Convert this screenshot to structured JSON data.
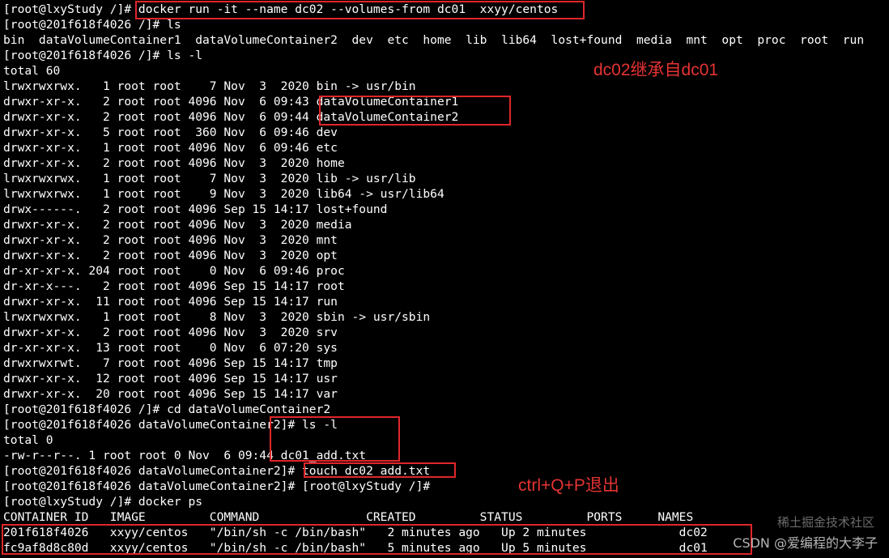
{
  "terminal": {
    "lines": [
      "[root@lxyStudy /]# docker run -it --name dc02 --volumes-from dc01  xxyy/centos",
      "[root@201f618f4026 /]# ls",
      "bin  dataVolumeContainer1  dataVolumeContainer2  dev  etc  home  lib  lib64  lost+found  media  mnt  opt  proc  root  run",
      "[root@201f618f4026 /]# ls -l",
      "total 60",
      "lrwxrwxrwx.   1 root root    7 Nov  3  2020 bin -> usr/bin",
      "drwxr-xr-x.   2 root root 4096 Nov  6 09:43 dataVolumeContainer1",
      "drwxr-xr-x.   2 root root 4096 Nov  6 09:44 dataVolumeContainer2",
      "drwxr-xr-x.   5 root root  360 Nov  6 09:46 dev",
      "drwxr-xr-x.   1 root root 4096 Nov  6 09:46 etc",
      "drwxr-xr-x.   2 root root 4096 Nov  3  2020 home",
      "lrwxrwxrwx.   1 root root    7 Nov  3  2020 lib -> usr/lib",
      "lrwxrwxrwx.   1 root root    9 Nov  3  2020 lib64 -> usr/lib64",
      "drwx------.   2 root root 4096 Sep 15 14:17 lost+found",
      "drwxr-xr-x.   2 root root 4096 Nov  3  2020 media",
      "drwxr-xr-x.   2 root root 4096 Nov  3  2020 mnt",
      "drwxr-xr-x.   2 root root 4096 Nov  3  2020 opt",
      "dr-xr-xr-x. 204 root root    0 Nov  6 09:46 proc",
      "dr-xr-x---.   2 root root 4096 Sep 15 14:17 root",
      "drwxr-xr-x.  11 root root 4096 Sep 15 14:17 run",
      "lrwxrwxrwx.   1 root root    8 Nov  3  2020 sbin -> usr/sbin",
      "drwxr-xr-x.   2 root root 4096 Nov  3  2020 srv",
      "dr-xr-xr-x.  13 root root    0 Nov  6 07:20 sys",
      "drwxrwxrwt.   7 root root 4096 Sep 15 14:17 tmp",
      "drwxr-xr-x.  12 root root 4096 Sep 15 14:17 usr",
      "drwxr-xr-x.  20 root root 4096 Sep 15 14:17 var",
      "[root@201f618f4026 /]# cd dataVolumeContainer2",
      "[root@201f618f4026 dataVolumeContainer2]# ls -l",
      "total 0",
      "-rw-r--r--. 1 root root 0 Nov  6 09:44 dc01_add.txt",
      "[root@201f618f4026 dataVolumeContainer2]# touch dc02_add.txt",
      "[root@201f618f4026 dataVolumeContainer2]# [root@lxyStudy /]#",
      "[root@lxyStudy /]# docker ps",
      "CONTAINER ID   IMAGE         COMMAND               CREATED         STATUS         PORTS     NAMES",
      "201f618f4026   xxyy/centos   \"/bin/sh -c /bin/bash\"   2 minutes ago   Up 2 minutes             dc02",
      "fc9af8d8c80d   xxyy/centos   \"/bin/sh -c /bin/bash\"   5 minutes ago   Up 5 minutes             dc01"
    ]
  },
  "annotations": {
    "inherit_note": "dc02继承自dc01",
    "detach_note": "ctrl+Q+P退出"
  },
  "watermark": {
    "primary": "CSDN @爱编程的大李子",
    "secondary": "稀土掘金技术社区"
  },
  "colors": {
    "background": "#000000",
    "text": "#ffffff",
    "annotation": "#e53333"
  }
}
